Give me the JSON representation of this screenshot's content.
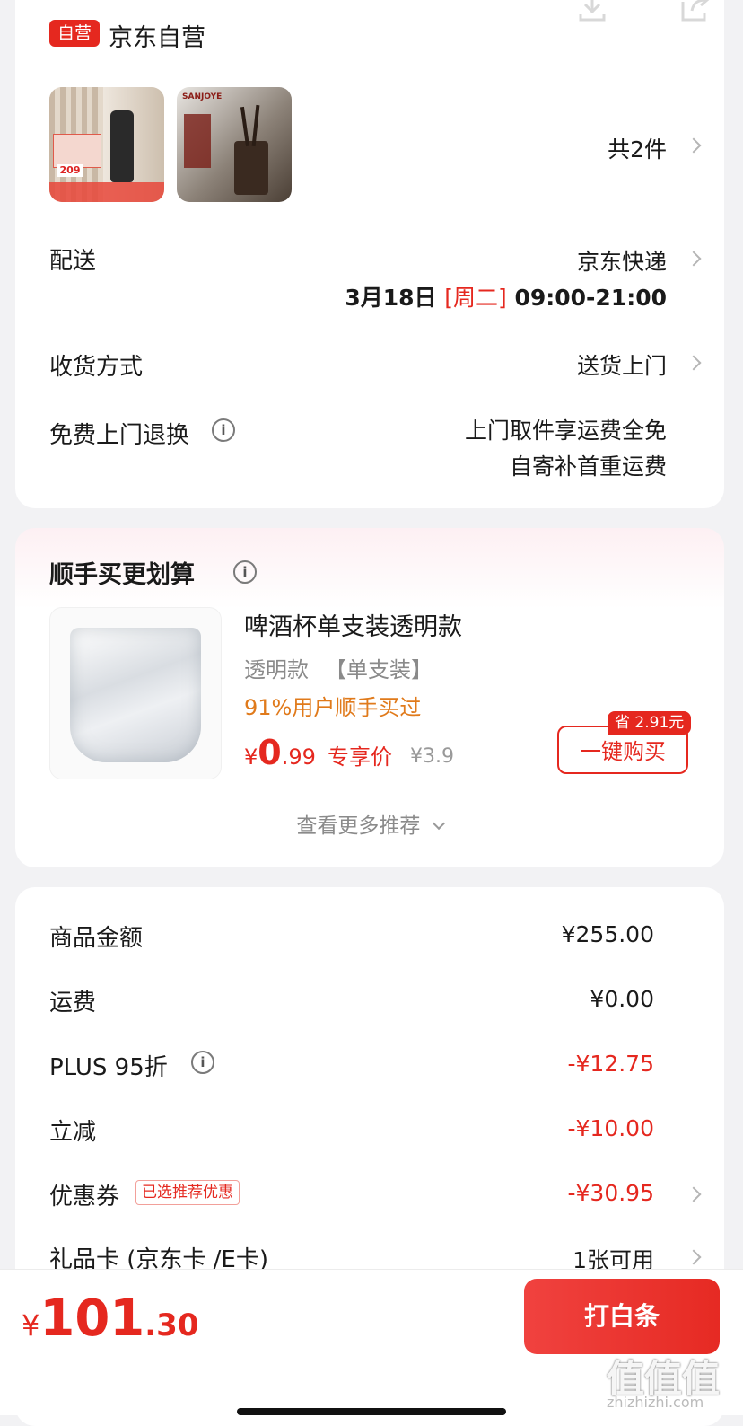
{
  "store": {
    "badge": "自营",
    "name": "京东自营"
  },
  "top_icons": [
    "download-icon",
    "share-icon"
  ],
  "items": {
    "count_text": "共2件",
    "thumb1_label": "209",
    "thumb2_brand": "SANJOYE"
  },
  "delivery": {
    "label": "配送",
    "carrier": "京东快递",
    "date": "3月18日",
    "weekday": "[周二]",
    "time": "09:00-21:00"
  },
  "receive": {
    "label": "收货方式",
    "value": "送货上门"
  },
  "free_return": {
    "label": "免费上门退换",
    "line1": "上门取件享运费全免",
    "line2": "自寄补首重运费"
  },
  "addon": {
    "title": "顺手买更划算",
    "product": {
      "name": "啤酒杯单支装透明款",
      "spec1": "透明款",
      "spec2": "【单支装】",
      "popularity": "91%用户顺手买过",
      "price_symbol": "¥",
      "price_int": "0",
      "price_dec": ".99",
      "price_tag": "专享价",
      "orig_price": "¥3.9",
      "save_badge": "省 2.91元",
      "buy_button": "一键购买"
    },
    "more": "查看更多推荐"
  },
  "summary": {
    "rows": [
      {
        "label": "商品金额",
        "value": "¥255.00"
      },
      {
        "label": "运费",
        "value": "¥0.00"
      },
      {
        "label": "PLUS 95折",
        "value": "-¥12.75"
      },
      {
        "label": "立减",
        "value": "-¥10.00"
      },
      {
        "label": "优惠券",
        "value": "-¥30.95",
        "tag": "已选推荐优惠"
      },
      {
        "label": "礼品卡 (京东卡 /E卡)",
        "value": "1张可用"
      }
    ]
  },
  "footer": {
    "total_symbol": "¥",
    "total_int": "101",
    "total_dec": ".30",
    "pay_button": "打白条"
  },
  "watermark": {
    "text": "值值值",
    "url": "zhizhizhi.com"
  },
  "colors": {
    "accent": "#e5281f",
    "orange": "#e07a1b",
    "bg": "#f2f2f4"
  }
}
